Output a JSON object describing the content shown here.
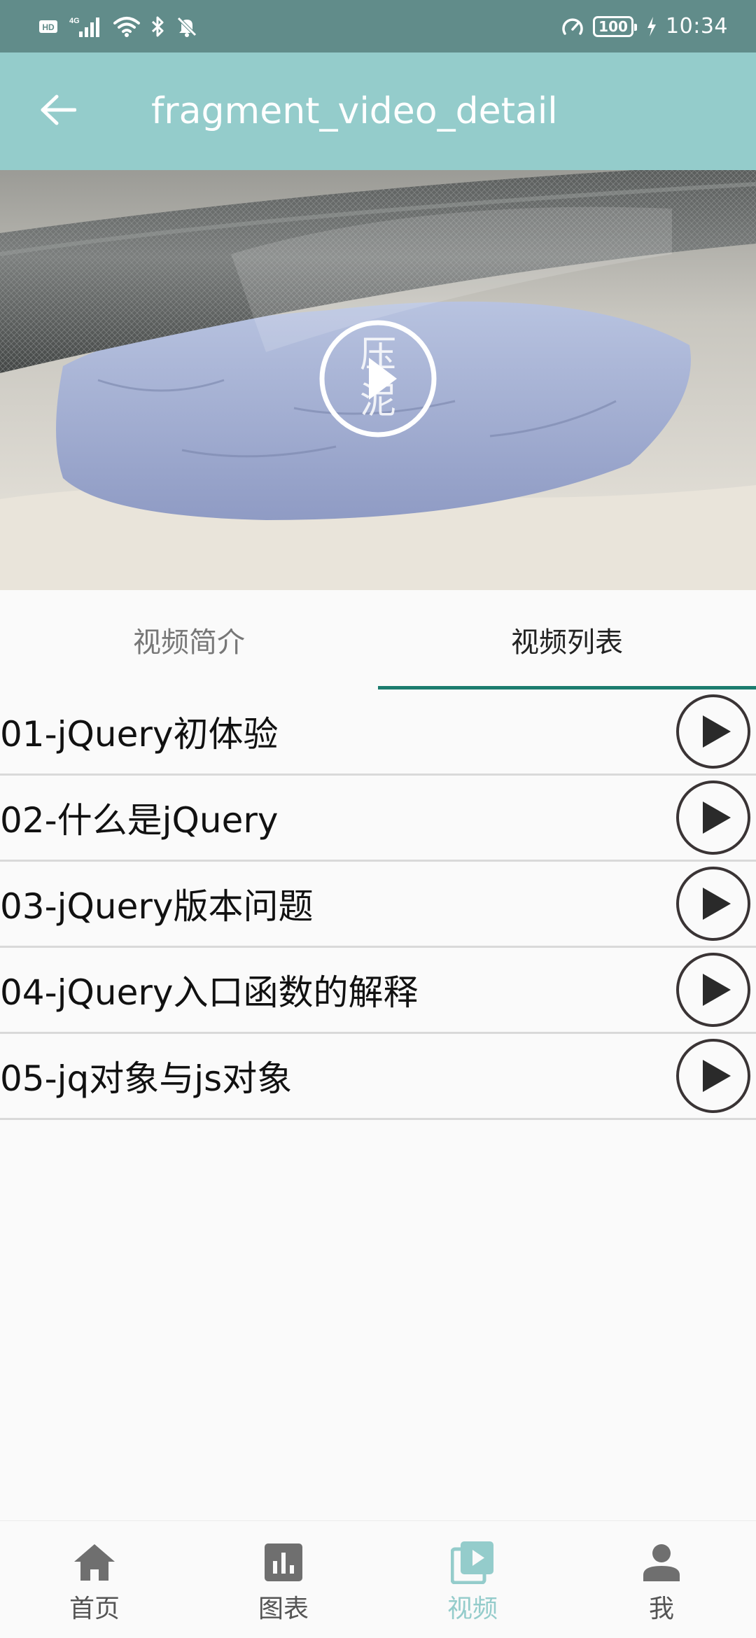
{
  "status_bar": {
    "left_icons": [
      "hd-icon",
      "signal-4g-icon",
      "wifi-icon",
      "bluetooth-icon",
      "mute-icon"
    ],
    "hd_label": "HD",
    "network_label": "4G",
    "battery": "100",
    "time": "10:34"
  },
  "app_bar": {
    "title": "fragment_video_detail"
  },
  "video": {
    "overlay_text_top": "压",
    "overlay_text_bottom": "泥"
  },
  "tabs": [
    {
      "label": "视频简介",
      "active": false
    },
    {
      "label": "视频列表",
      "active": true
    }
  ],
  "video_list": [
    {
      "title": "01-jQuery初体验"
    },
    {
      "title": "02-什么是jQuery"
    },
    {
      "title": "03-jQuery版本问题"
    },
    {
      "title": "04-jQuery入口函数的解释"
    },
    {
      "title": "05-jq对象与js对象"
    }
  ],
  "bottom_nav": [
    {
      "label": "首页",
      "icon": "home-icon",
      "active": false
    },
    {
      "label": "图表",
      "icon": "chart-icon",
      "active": false
    },
    {
      "label": "视频",
      "icon": "video-library-icon",
      "active": true
    },
    {
      "label": "我",
      "icon": "person-icon",
      "active": false
    }
  ],
  "colors": {
    "status_bar": "#618c8a",
    "app_bar": "#94cccb",
    "tab_indicator": "#1b7c6e",
    "nav_active": "#94cccb"
  }
}
